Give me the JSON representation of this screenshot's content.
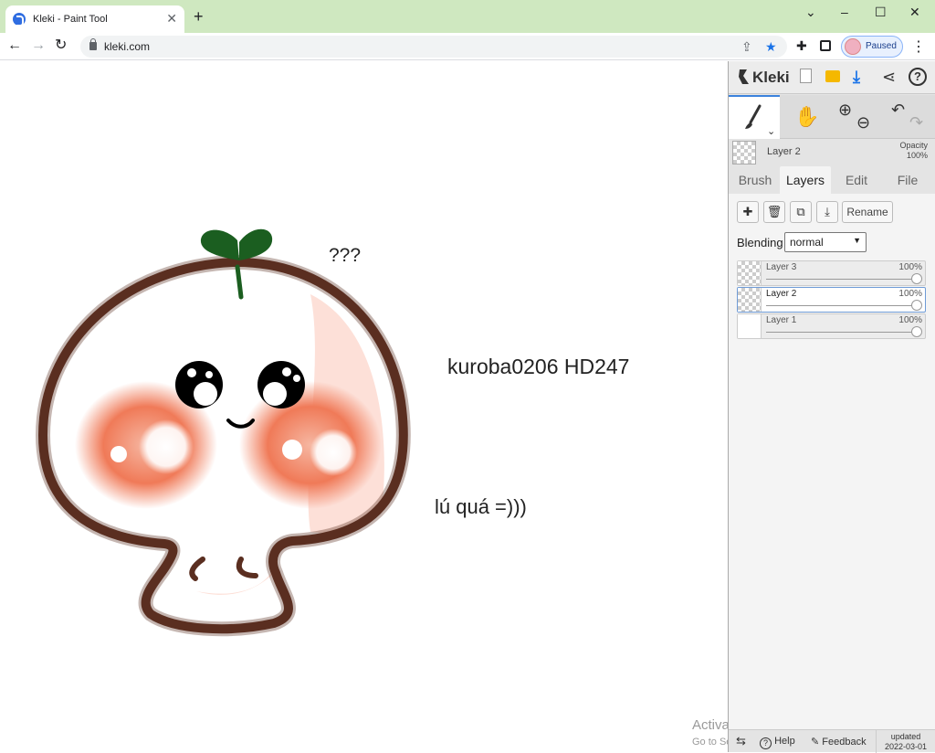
{
  "browser": {
    "tab_title": "Kleki - Paint Tool",
    "tab_close": "✕",
    "new_tab": "+",
    "url": "kleki.com",
    "profile_status": "Paused",
    "window_controls": {
      "dropdown": "⌄",
      "minimize": "–",
      "maximize": "☐",
      "close": "✕"
    },
    "nav": {
      "back": "←",
      "forward": "→",
      "reload": "↻"
    }
  },
  "canvas": {
    "question_text": "???",
    "credit_text": "kuroba0206   HD247",
    "caption_text": "lú quá =)))"
  },
  "watermark": {
    "title": "Activate Windows",
    "subtitle": "Go to Settings to activate Windows."
  },
  "panel": {
    "logo": "Kleki",
    "current_layer": "Layer 2",
    "opacity_label": "Opacity",
    "opacity_value": "100%",
    "tabs": [
      "Brush",
      "Layers",
      "Edit",
      "File"
    ],
    "active_tab": "Layers",
    "rename_label": "Rename",
    "blending_label": "Blending",
    "blending_value": "normal",
    "layers": [
      {
        "name": "Layer 3",
        "opacity": "100%"
      },
      {
        "name": "Layer 2",
        "opacity": "100%"
      },
      {
        "name": "Layer 1",
        "opacity": "100%"
      }
    ],
    "selected_layer": "Layer 2",
    "footer": {
      "help": "Help",
      "feedback": "Feedback",
      "updated_label": "updated",
      "updated_date": "2022-03-01"
    }
  },
  "colors": {
    "accent": "#3c82dc",
    "titlebar": "#cfe8c0",
    "outline_brown": "#5a2e20",
    "blush": "#f07050",
    "sprout_green": "#1b5e20"
  }
}
